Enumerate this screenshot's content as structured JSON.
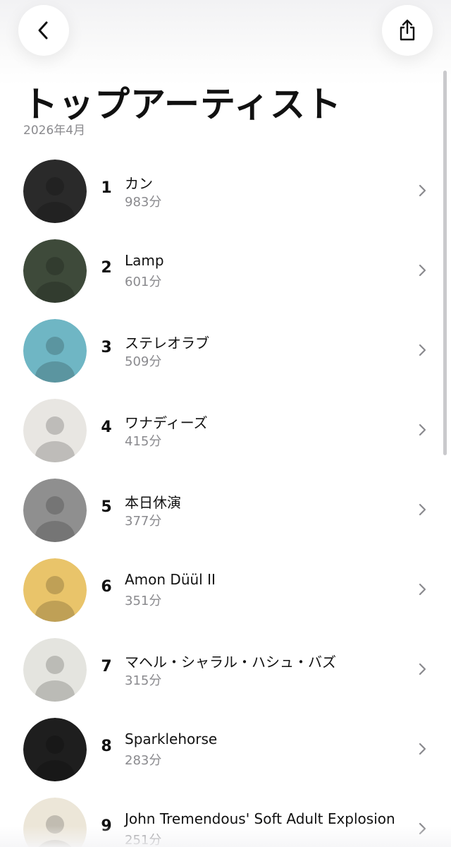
{
  "header": {
    "back_icon": "chevron-left-icon",
    "share_icon": "share-icon",
    "title": "トップアーティスト",
    "subtitle": "2026年4月"
  },
  "artists": [
    {
      "rank": "1",
      "name": "カン",
      "minutes": "983分",
      "avatar_color": "#2a2a2a"
    },
    {
      "rank": "2",
      "name": "Lamp",
      "minutes": "601分",
      "avatar_color": "#3e4a3a"
    },
    {
      "rank": "3",
      "name": "ステレオラブ",
      "minutes": "509分",
      "avatar_color": "#6fb6c4"
    },
    {
      "rank": "4",
      "name": "ワナディーズ",
      "minutes": "415分",
      "avatar_color": "#e8e6e2"
    },
    {
      "rank": "5",
      "name": "本日休演",
      "minutes": "377分",
      "avatar_color": "#8f8f8f"
    },
    {
      "rank": "6",
      "name": "Amon Düül II",
      "minutes": "351分",
      "avatar_color": "#e9c46a"
    },
    {
      "rank": "7",
      "name": "マヘル・シャラル・ハシュ・バズ",
      "minutes": "315分",
      "avatar_color": "#e4e4df"
    },
    {
      "rank": "8",
      "name": "Sparklehorse",
      "minutes": "283分",
      "avatar_color": "#1e1e1e"
    },
    {
      "rank": "9",
      "name": "John Tremendous' Soft Adult Explosion",
      "minutes": "251分",
      "avatar_color": "#ece6d8"
    }
  ],
  "row_chevron_icon": "chevron-right-icon"
}
